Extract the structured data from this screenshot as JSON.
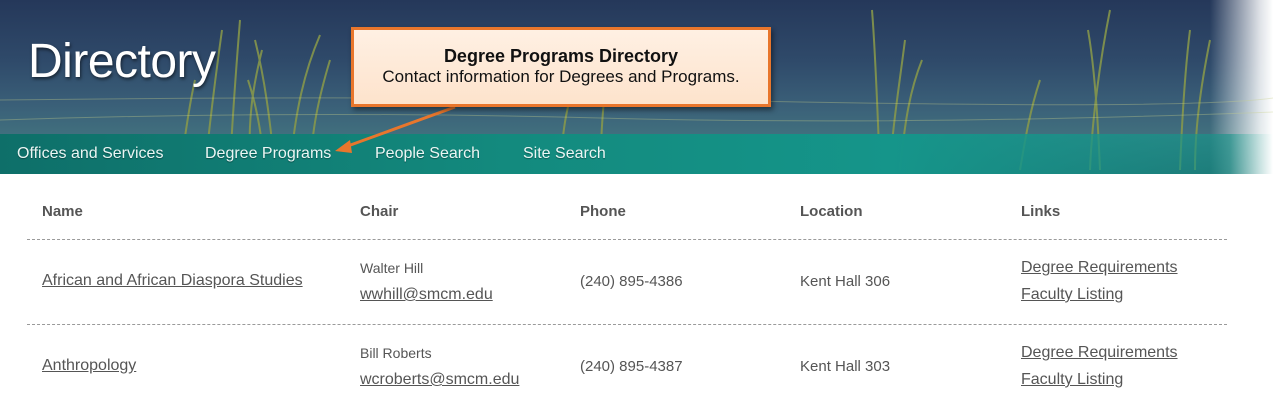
{
  "header": {
    "title": "Directory"
  },
  "nav": {
    "items": [
      {
        "label": "Offices and Services"
      },
      {
        "label": "Degree Programs"
      },
      {
        "label": "People Search"
      },
      {
        "label": "Site Search"
      }
    ]
  },
  "callout": {
    "title": "Degree Programs Directory",
    "body": "Contact information for Degrees and Programs."
  },
  "table": {
    "columns": [
      "Name",
      "Chair",
      "Phone",
      "Location",
      "Links"
    ],
    "rows": [
      {
        "name": "African and African Diaspora Studies",
        "chair_name": "Walter Hill",
        "chair_email": "wwhill@smcm.edu",
        "phone": "(240) 895-4386",
        "location": "Kent Hall 306",
        "link1": "Degree Requirements",
        "link2": "Faculty Listing"
      },
      {
        "name": "Anthropology",
        "chair_name": "Bill Roberts",
        "chair_email": "wcroberts@smcm.edu",
        "phone": "(240) 895-4387",
        "location": "Kent Hall 303",
        "link1": "Degree Requirements",
        "link2": "Faculty Listing"
      }
    ]
  },
  "colors": {
    "nav_teal": "#138a7e",
    "callout_border": "#e8762c",
    "callout_fill": "#fde3cc",
    "text_gray": "#555555"
  }
}
